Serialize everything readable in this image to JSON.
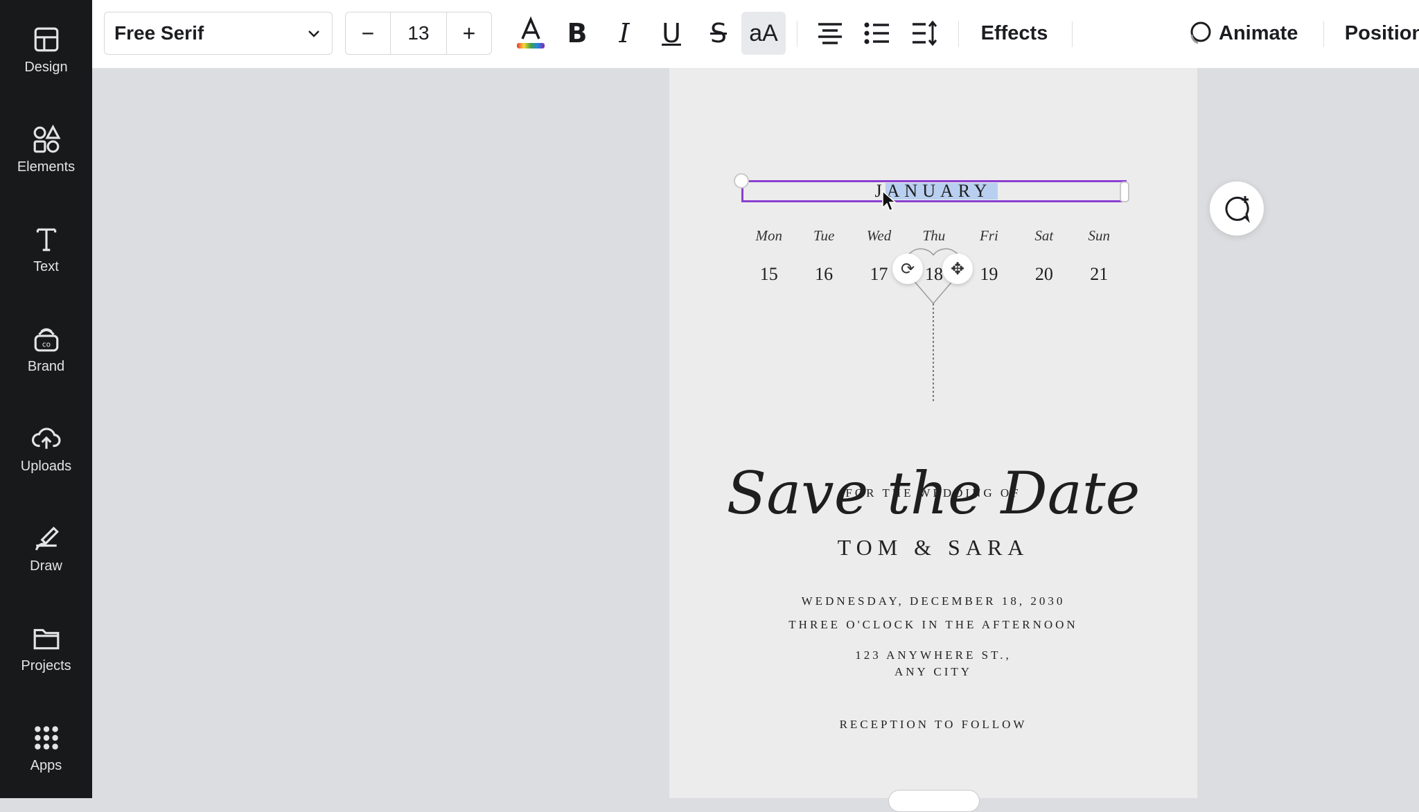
{
  "sidebar": {
    "items": [
      {
        "label": "Design",
        "icon": "design-icon"
      },
      {
        "label": "Elements",
        "icon": "elements-icon"
      },
      {
        "label": "Text",
        "icon": "text-icon"
      },
      {
        "label": "Brand",
        "icon": "brand-icon"
      },
      {
        "label": "Uploads",
        "icon": "uploads-icon"
      },
      {
        "label": "Draw",
        "icon": "draw-icon"
      },
      {
        "label": "Projects",
        "icon": "projects-icon"
      },
      {
        "label": "Apps",
        "icon": "apps-icon"
      }
    ]
  },
  "toolbar": {
    "font_name": "Free Serif",
    "font_size": "13",
    "decrease": "−",
    "increase": "+",
    "case_label": "aA",
    "effects_label": "Effects",
    "animate_label": "Animate",
    "position_label": "Position"
  },
  "design": {
    "month": "JANUARY",
    "weekdays": [
      "Mon",
      "Tue",
      "Wed",
      "Thu",
      "Fri",
      "Sat",
      "Sun"
    ],
    "dates": [
      "15",
      "16",
      "17",
      "18",
      "19",
      "20",
      "21"
    ],
    "title": "Save the Date",
    "subtitle": "FOR THE WEDDING OF",
    "names": "TOM & SARA",
    "date_line": "WEDNESDAY, DECEMBER 18, 2030",
    "time_line": "THREE O'CLOCK IN THE AFTERNOON",
    "address_line1": "123 ANYWHERE ST.,",
    "address_line2": "ANY CITY",
    "reception": "RECEPTION TO FOLLOW"
  },
  "colors": {
    "selection_border": "#8b3fd0",
    "text_highlight": "#b8cff0",
    "sidebar_bg": "#18191b"
  }
}
